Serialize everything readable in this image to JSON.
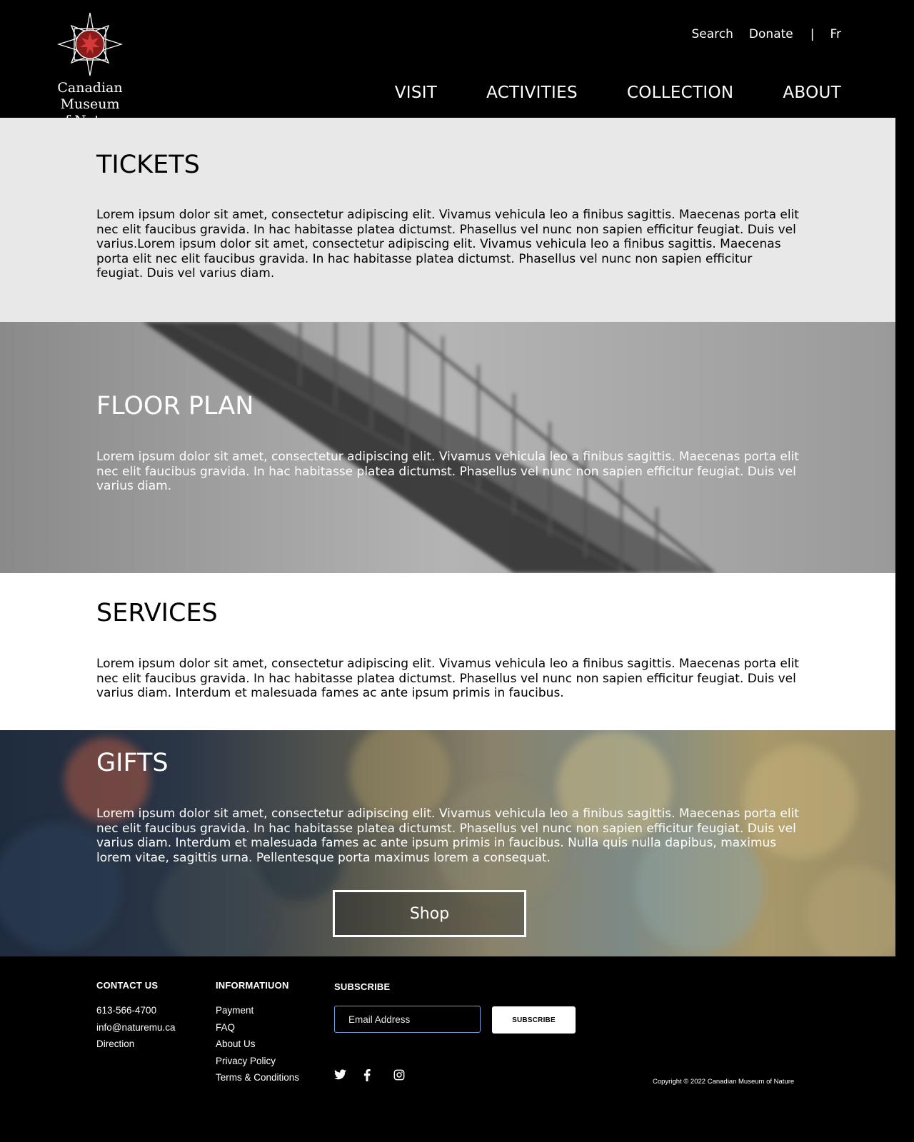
{
  "header": {
    "logo_text": "Canadian Museum\nof Nature",
    "util_links": [
      "Search",
      "Donate"
    ],
    "separator": "|",
    "lang": "Fr",
    "nav": [
      "VISIT",
      "ACTIVITIES",
      "COLLECTION",
      "ABOUT"
    ]
  },
  "sections": {
    "tickets": {
      "title": "TICKETS",
      "body": "Lorem ipsum dolor sit amet, consectetur adipiscing elit. Vivamus vehicula leo a finibus sagittis. Maecenas porta elit nec elit faucibus gravida. In hac habitasse platea dictumst. Phasellus vel nunc non sapien efficitur feugiat. Duis vel varius.Lorem ipsum dolor sit amet, consectetur adipiscing elit. Vivamus vehicula leo a finibus sagittis. Maecenas porta elit nec elit faucibus gravida. In hac habitasse platea dictumst. Phasellus vel  nunc non sapien efficitur feugiat. Duis vel varius diam."
    },
    "floor_plan": {
      "title": "FLOOR PLAN",
      "body": "Lorem ipsum dolor sit amet, consectetur adipiscing elit. Vivamus vehicula leo a finibus sagittis. Maecenas porta elit nec elit faucibus gravida. In hac habitasse platea dictumst. Phasellus vel  nunc non sapien efficitur feugiat. Duis vel varius diam."
    },
    "services": {
      "title": "SERVICES",
      "body": "Lorem ipsum dolor sit amet, consectetur adipiscing elit. Vivamus vehicula leo a finibus sagittis. Maecenas porta elit nec elit faucibus gravida. In hac habitasse platea dictumst. Phasellus vel nunc non sapien efficitur feugiat. Duis vel varius diam. Interdum et malesuada fames ac ante ipsum primis in faucibus."
    },
    "gifts": {
      "title": "GIFTS",
      "body": "Lorem ipsum dolor sit amet, consectetur adipiscing elit. Vivamus vehicula leo a finibus sagittis. Maecenas porta elit nec elit faucibus gravida. In hac habitasse platea dictumst. Phasellus vel nunc non sapien efficitur feugiat. Duis vel varius diam. Interdum et malesuada fames ac ante ipsum primis in faucibus. Nulla quis nulla dapibus, maximus lorem vitae, sagittis urna. Pellentesque porta maximus lorem a consequat.",
      "button": "Shop"
    }
  },
  "footer": {
    "contact": {
      "heading": "CONTACT US",
      "items": [
        "613-566-4700",
        "info@naturemu.ca",
        "Direction"
      ]
    },
    "info": {
      "heading": "INFORMATIUON",
      "items": [
        "Payment",
        "FAQ",
        "About Us",
        "Privacy Policy",
        "Terms & Conditions"
      ]
    },
    "subscribe": {
      "heading": "SUBSCRIBE",
      "email_placeholder": "Email Address",
      "button": "SUBSCRIBE"
    },
    "social_icons": [
      "twitter-icon",
      "facebook-icon",
      "instagram-icon"
    ],
    "copyright": "Copyright © 2022 Canadian Museum of Nature"
  },
  "colors": {
    "header_bg": "#000000",
    "tickets_bg": "#e8e8e8",
    "services_bg": "#ffffff",
    "email_border": "#6ea2e0"
  }
}
